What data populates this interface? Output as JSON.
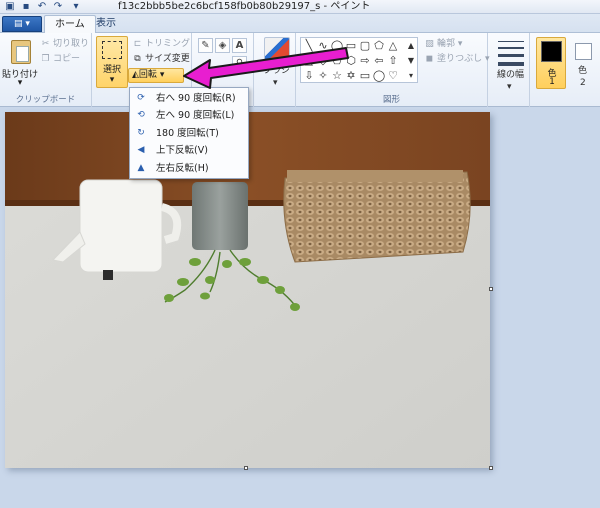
{
  "titlebar": {
    "title": "f13c2bbb5be2c6bcf158fb0b80b29197_s - ペイント",
    "quick_access": [
      "save-icon",
      "undo-icon",
      "redo-icon",
      "customize-icon"
    ]
  },
  "tabs": {
    "file": "▤ ▾",
    "home": "ホーム",
    "view": "表示"
  },
  "clipboard": {
    "paste": "貼り付け",
    "paste_arrow": "▾",
    "cut": "切り取り",
    "copy": "コピー",
    "label": "クリップボード"
  },
  "image": {
    "select": "選択",
    "select_arrow": "▾",
    "crop": "トリミング",
    "resize": "サイズ変更",
    "rotate": "回転",
    "rotate_arrow": "▾"
  },
  "tools": {
    "brushes": "ブラシ",
    "brushes_arrow": "▾"
  },
  "shapes": {
    "outline": "輪郭",
    "fill": "塗りつぶし",
    "label": "図形"
  },
  "size": {
    "label": "線の幅"
  },
  "colors": {
    "color1": "色",
    "color1_num": "1",
    "color2": "色",
    "color2_num": "2",
    "color1_hex": "#000000",
    "color2_hex": "#ffffff"
  },
  "rotate_menu": [
    {
      "label": "右へ 90 度回転(R)",
      "icon": "rotate-right-icon"
    },
    {
      "label": "左へ 90 度回転(L)",
      "icon": "rotate-left-icon"
    },
    {
      "label": "180 度回転(T)",
      "icon": "rotate-180-icon"
    },
    {
      "label": "上下反転(V)",
      "icon": "flip-vertical-icon"
    },
    {
      "label": "左右反転(H)",
      "icon": "flip-horizontal-icon"
    }
  ],
  "annotation": {
    "arrow_color": "#e81ed0"
  }
}
